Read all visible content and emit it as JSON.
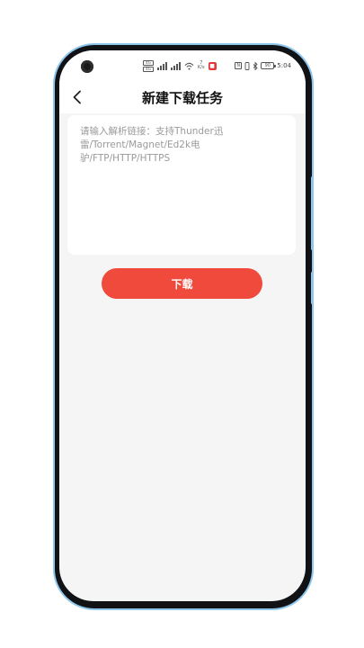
{
  "status_bar": {
    "sim1": "4G",
    "sim2": "4G",
    "net_speed_value": "7",
    "net_speed_unit": "K/s",
    "notification_badge": "■",
    "nfc": "N",
    "battery": "90",
    "time": "5:04"
  },
  "header": {
    "back_icon": "chevron-left-icon",
    "title": "新建下载任务"
  },
  "link_input": {
    "value": "",
    "placeholder": "请输入解析链接：支持Thunder迅雷/Torrent/Magnet/Ed2k电驴/FTP/HTTP/HTTPS"
  },
  "actions": {
    "download_label": "下载"
  },
  "colors": {
    "accent": "#ef4a3c",
    "background": "#f5f5f5",
    "frame": "#8fc6ec"
  }
}
